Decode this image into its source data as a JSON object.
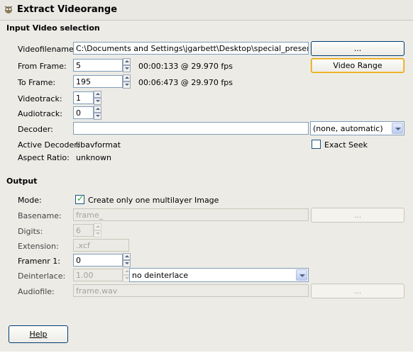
{
  "window": {
    "title": "Extract Videorange"
  },
  "input": {
    "section_title": "Input Video selection",
    "videofilename": {
      "label": "Videofilename:",
      "value": "C:\\Documents and Settings\\jgarbett\\Desktop\\special_presentation.m",
      "browse_label": "..."
    },
    "from_frame": {
      "label": "From Frame:",
      "value": "5",
      "timecode": "00:00:133 @ 29.970 fps"
    },
    "video_range_label": "Video Range",
    "to_frame": {
      "label": "To Frame:",
      "value": "195",
      "timecode": "00:06:473 @ 29.970 fps"
    },
    "videotrack": {
      "label": "Videotrack:",
      "value": "1"
    },
    "audiotrack": {
      "label": "Audiotrack:",
      "value": "0"
    },
    "decoder": {
      "label": "Decoder:",
      "value": "",
      "option": "(none, automatic)"
    },
    "active_decoder": {
      "label": "Active Decoder:",
      "value": "libavformat"
    },
    "exact_seek": {
      "label": "Exact Seek",
      "checked": false
    },
    "aspect_ratio": {
      "label": "Aspect Ratio:",
      "value": "unknown"
    }
  },
  "output": {
    "section_title": "Output",
    "mode": {
      "label": "Mode:",
      "checkbox_label": "Create only one multilayer Image",
      "checked": true
    },
    "basename": {
      "label": "Basename:",
      "value": "frame_",
      "browse_label": "..."
    },
    "digits": {
      "label": "Digits:",
      "value": "6"
    },
    "extension": {
      "label": "Extension:",
      "value": ".xcf"
    },
    "framenr": {
      "label": "Framenr 1:",
      "value": "0"
    },
    "deinterlace": {
      "label": "Deinterlace:",
      "value": "1.00",
      "option": "no deinterlace"
    },
    "audiofile": {
      "label": "Audiofile:",
      "value": "frame.wav",
      "browse_label": "..."
    }
  },
  "help_label": "Help"
}
